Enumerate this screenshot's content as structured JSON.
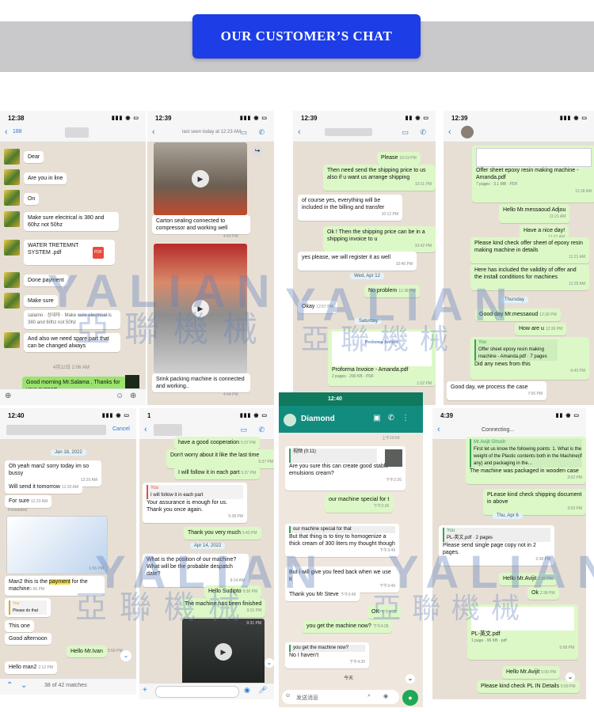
{
  "banner": {
    "title": "OUR CUSTOMER’S CHAT"
  },
  "watermark": {
    "latin": "YALIAN",
    "chinese": "亞聯機械"
  },
  "chats": [
    {
      "time": "12:38",
      "badge": "188",
      "messages": [
        "Dear",
        "Are you in line",
        "On",
        "Make sure electrical is 380 and 60hz not 50hz",
        "WATER TRETEMNT SYSTEM .pdf",
        "Done payment",
        "Make sure",
        "salamo · 상대마 · Make sure electrical is 380 and 60hz not 50hz",
        "And also we need spare part that can be changed always",
        "4月12日 2:06 AM",
        "Good morning Mr.Salama , Thanks for your support"
      ],
      "pdf": "PDF"
    },
    {
      "time": "12:39",
      "subtitle": "last seen today at 12:23 AM",
      "messages": [
        "Carton sealing connected to compressor and working well",
        "4:43 PM",
        "Srink packing machine is connected and working..",
        "4:44 PM"
      ]
    },
    {
      "time": "12:39",
      "messages": [
        "Please",
        "10:19 PM",
        "Then need send the shipping price to us also if u want us arrange shipping",
        "10:11 PM",
        "of course yes, everything will be included in the billing and transfer",
        "10:12 PM",
        "Ok ! Then the shipping price can be in a shipping invoice to u",
        "10:42 PM",
        "yes please, we will register it as well",
        "10:45 PM",
        "Wed, Apr 12",
        "No problem",
        "12:38 PM",
        "Okay",
        "12:57 PM",
        "Saturday",
        "Proforma Invoice - Amanda.pdf",
        "2 pages · 290 KB · PDF",
        "1:02 PM"
      ]
    },
    {
      "time": "12:39",
      "messages": [
        "Offer sheet epoxy resin making machine - Amanda.pdf",
        "7 pages · 3.1 MB · PDF",
        "11:18 AM",
        "Hello Mr.messaoud Adjou",
        "11:21 AM",
        "Have a nice day!",
        "11:21 AM",
        "Please kind check offer sheet of epoxy resin making machine in details",
        "11:21 AM",
        "Here has included the validity of offer and the install conditions for machines",
        "11:25 AM",
        "Thursday",
        "Good day Mr.messaoud",
        "12:36 PM",
        "How are u",
        "12:36 PM",
        "You",
        "Offer sheet epoxy resin making machine - Amanda.pdf · 7 pages",
        "Did any news from this",
        "6:43 PM",
        "Good day, we process the case",
        "7:06 PM"
      ]
    },
    {
      "time": "12:40",
      "cancel": "Cancel",
      "messages": [
        "Jan 18, 2022",
        "Oh yeah man2 sorry today im so bussy",
        "12:20 AM",
        "Will send it tomorrow",
        "12:20 AM",
        "For sure",
        "12:23 AM",
        "Forwarded",
        "1:56 PM",
        "Man2 this is the",
        "payment",
        "for the machine",
        "1:56 PM",
        "You",
        "Please do that",
        "This one",
        "Good afternoon",
        "5:56 PM",
        "Hello Mr.Ivan",
        "Hello man2",
        "2:12 PM"
      ],
      "search": "38 of 42 matches"
    },
    {
      "time": "1",
      "messages": [
        "have a good cooperation",
        "5:37 PM",
        "Don't worry about it like the last time",
        "5:37 PM",
        "I will follow it in each part",
        "5:37 PM",
        "You",
        "I will follow it in each part",
        "Your assurance is enough for us. Thank you once again.",
        "5:38 PM",
        "Thank you very much",
        "5:40 PM",
        "Apr 14, 2022",
        "What is the position of our machine? What will be the probable despatch date?",
        "9:14 AM",
        "Hello Sudipto",
        "9:30 PM",
        "The machine has been finished",
        "9:31 PM",
        "9:31 PM"
      ]
    },
    {
      "time": "12:40",
      "name": "Diamond",
      "messages": [
        "上午10:59",
        "视频 (0:11)",
        "Are you sure this can create good stable emulsions cream?",
        "下午2:26",
        "our machine special for t",
        "下午2:26",
        "our machine special for that",
        "But that thing is to tiny to homogenize a thick cream of 300 liters my thought though",
        "下午3:49",
        "But i will give you feed back when we use it",
        "下午3:49",
        "Thank you Mr Steve",
        "下午3:49",
        "OK",
        "下午4:28",
        "you get the machine now?",
        "下午4:28",
        "you get the machine now?",
        "No I haven't",
        "下午4:30",
        "今天",
        "发送消息"
      ]
    },
    {
      "time": "4:39",
      "connecting": "Connecting...",
      "messages": [
        "Mr.Avijit Ghosh",
        "First let us know the following points: 1. What is the weight of the Plastic contents both in the Machine(if any) and packaging in the...",
        "The machine was packaged in wooden case",
        "3:52 PM",
        "PLease kind check shipping document in above",
        "3:53 PM",
        "Thu, Apr 6",
        "You",
        "PL-英文.pdf · 2 pages",
        "Please send single page copy not in 2 pages.",
        "2:38 PM",
        "Hello Mr.Avijit",
        "2:38 PM",
        "Ok",
        "2:38 PM",
        "PL-英文.pdf",
        "1 page · 96 KB · pdf",
        "5:08 PM",
        "Hello Mr.Avijit",
        "5:09 PM",
        "Please kind check PL IN Details",
        "5:09 PM"
      ]
    }
  ]
}
